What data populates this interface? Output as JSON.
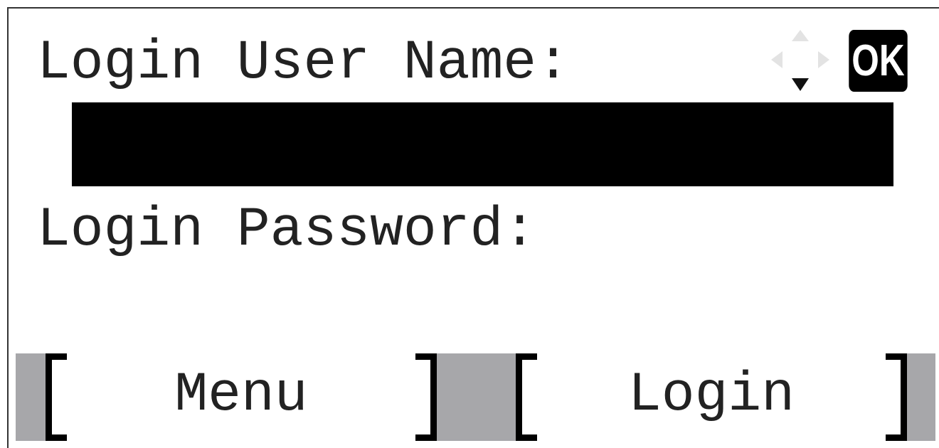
{
  "screen": {
    "username_label": "Login User Name:",
    "username_value": "",
    "password_label": "Login Password:",
    "password_value": ""
  },
  "keys": {
    "ok_label": "OK",
    "nav_icon": "dpad-arrows-icon"
  },
  "softkeys": {
    "left_label": "Menu",
    "right_label": "Login"
  },
  "colors": {
    "softkey_bar": "#a7a7aa",
    "selected_field": "#000000",
    "text": "#222222"
  }
}
